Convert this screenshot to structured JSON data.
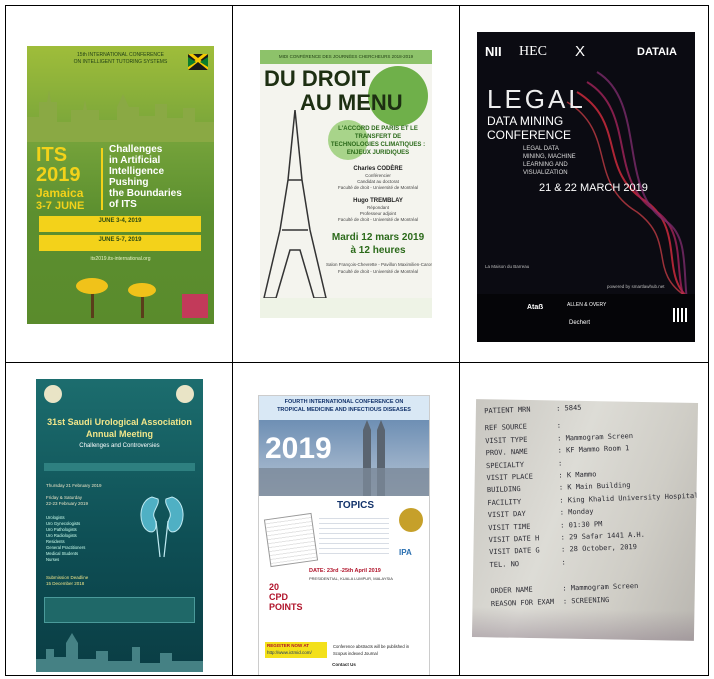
{
  "posters": {
    "its": {
      "header": "15th INTERNATIONAL CONFERENCE",
      "header2": "ON INTELLIGENT TUTORING SYSTEMS",
      "title": "ITS",
      "year": "2019",
      "place": "Jamaica",
      "dates": "3-7 JUNE",
      "tagline1": "Challenges",
      "tagline2": "in Artificial",
      "tagline3": "Intelligence",
      "tagline4": "Pushing",
      "tagline5": "the Boundaries",
      "tagline6": "of ITS",
      "box1": "JUNE 3-4, 2019",
      "box2": "JUNE 5-7, 2019",
      "web": "its2019.its-international.org"
    },
    "droit": {
      "header": "MIDI CONFÉRENCE DES JOURNÉES CHERCHEURS 2018-2019",
      "title1": "DU DROIT",
      "title2": "AU MENU",
      "subtitle1": "L'ACCORD DE PARIS ET LE",
      "subtitle2": "TRANSFERT DE",
      "subtitle3": "TECHNOLOGIES CLIMATIQUES :",
      "subtitle4": "ENJEUX JURIDIQUES",
      "speaker1": "Charles CODÈRE",
      "speaker1_role": "Conférencier",
      "speaker1_role2": "Candidat au doctorat",
      "speaker1_aff": "Faculté de droit - Université de Montréal",
      "speaker2": "Hugo TREMBLAY",
      "speaker2_role": "Répondant",
      "speaker2_role2": "Professeur adjoint",
      "speaker2_aff": "Faculté de droit - Université de Montréal",
      "date": "Mardi 12 mars 2019",
      "time": "à 12 heures",
      "venue1": "Salon François-Chevrette - Pavillon Maximilien-Caron",
      "venue2": "Faculté de droit - Université de Montréal"
    },
    "legal": {
      "logo1": "NII",
      "logo2": "HEC",
      "logo3": "X",
      "logo4": "DATAIA",
      "title1": "LEGAL",
      "title2": "DATA MINING",
      "title3": "CONFERENCE",
      "sub1": "LEGAL DATA",
      "sub2": "MINING, MACHINE",
      "sub3": "LEARNING AND",
      "sub4": "VISUALIZATION",
      "dates": "21 & 22 MARCH 2019",
      "venue": "La Maison du Barreau",
      "footer": "powered by smartlawhub.net",
      "s1": "Ataẞ",
      "s2": "ALLEN & OVERY",
      "s3": "Dechert"
    },
    "saudi": {
      "title1": "31st Saudi Urological Association",
      "title2": "Annual Meeting",
      "subtitle": "Challenges and Controversies",
      "date1": "Thursday 21 February 2019",
      "date2": "Friday & Saturday",
      "date3": "22-23 February 2019",
      "aud0": "Urologists",
      "aud1": "Uro Gynecologists",
      "aud2": "Uro Pathologists",
      "aud3": "Uro Radiologists",
      "aud4": "Residents",
      "aud5": "General Practitioners",
      "aud6": "Medical Students",
      "aud7": "Nurses",
      "deadline": "Submission Deadline",
      "deadline_date": "15 December 2018"
    },
    "tropical": {
      "header1": "FOURTH INTERNATIONAL CONFERENCE ON",
      "header2": "TROPICAL MEDICINE AND INFECTIOUS DISEASES",
      "year": "2019",
      "topics": "TOPICS",
      "date": "DATE: 23rd -25th April 2019",
      "venue": "PRESIDENTIAL, KUALA LUMPUR, MALAYSIA",
      "cpd1": "20",
      "cpd2": "CPD",
      "cpd3": "POINTS",
      "register1": "REGISTER NOW AT",
      "register2": "http://www.ictmid.com/",
      "abstract1": "Conference abstracts will be published in",
      "abstract2": "Scopus indexed Journal",
      "contact": "Contact Us",
      "ipa": "IPA"
    },
    "slip": {
      "r0k": "PATIENT MRN",
      "r0v": ": 5845",
      "r1k": "REF SOURCE",
      "r1v": ":",
      "r2k": "VISIT TYPE",
      "r2v": ": Mammogram Screen",
      "r3k": "PROV. NAME",
      "r3v": ": KF Mammo Room 1",
      "r4k": "SPECIALTY",
      "r4v": ":",
      "r5k": "VISIT PLACE",
      "r5v": ": K Mammo",
      "r6k": "BUILDING",
      "r6v": ": K Main Building",
      "r7k": "FACILITY",
      "r7v": ": King Khalid University Hospital",
      "r8k": "VISIT DAY",
      "r8v": ": Monday",
      "r9k": "VISIT TIME",
      "r9v": ": 01:30 PM",
      "r10k": "VISIT DATE H",
      "r10v": ": 29 Safar 1441 A.H.",
      "r11k": "VISIT DATE G",
      "r11v": ": 28 October, 2019",
      "r12k": "TEL. NO",
      "r12v": ":",
      "r13k": "ORDER NAME",
      "r13v": ": Mammogram Screen",
      "r14k": "REASON FOR EXAM",
      "r14v": ": SCREENING"
    }
  }
}
